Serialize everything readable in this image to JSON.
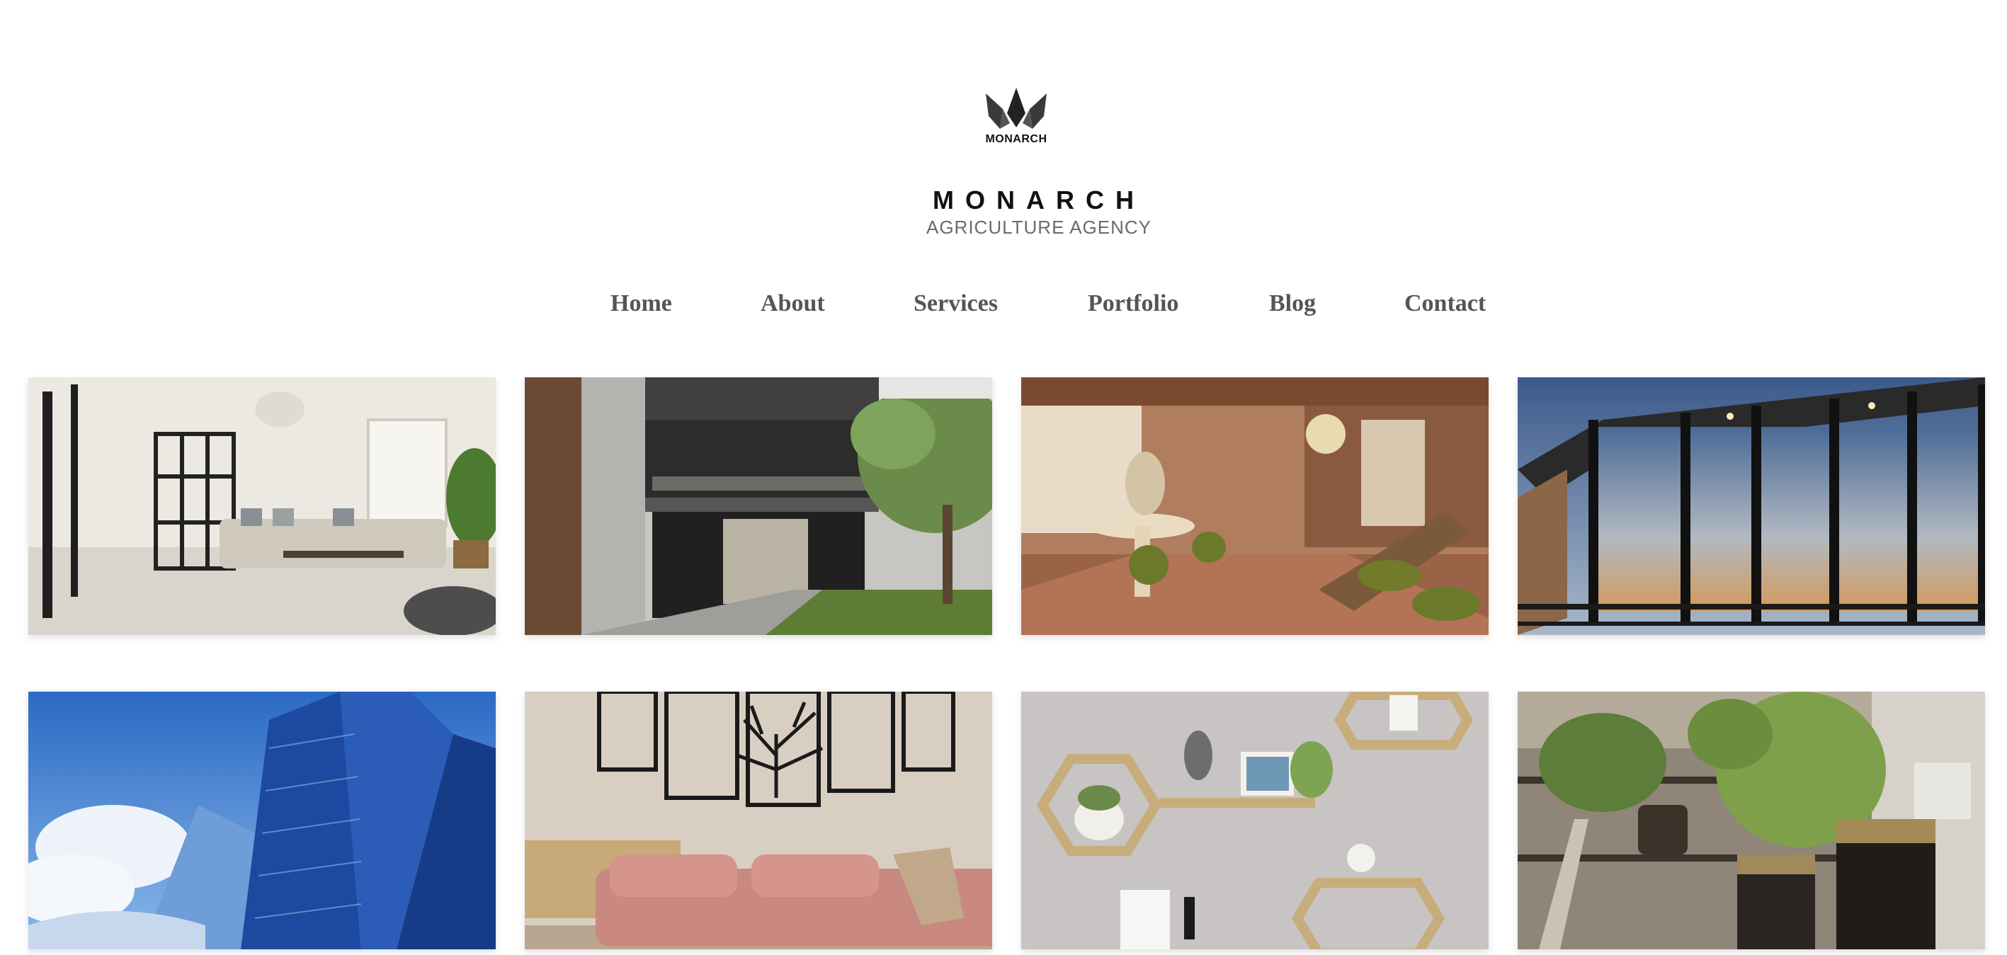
{
  "logo": {
    "icon": "crown-wings-logo",
    "text": "MONARCH"
  },
  "brand": {
    "name": "MONARCH",
    "tagline": "AGRICULTURE  AGENCY"
  },
  "nav": {
    "items": [
      {
        "label": "Home"
      },
      {
        "label": "About"
      },
      {
        "label": "Services"
      },
      {
        "label": "Portfolio"
      },
      {
        "label": "Blog"
      },
      {
        "label": "Contact"
      }
    ]
  },
  "gallery": {
    "images": [
      {
        "subject": "bright-living-room-with-glass-partition"
      },
      {
        "subject": "modern-house-with-garden-courtyard"
      },
      {
        "subject": "warm-retro-interior-with-dining-bar"
      },
      {
        "subject": "modern-glass-facade-balcony"
      },
      {
        "subject": "blue-glass-skyscrapers"
      },
      {
        "subject": "pink-sofa-with-tree-wall-art"
      },
      {
        "subject": "hexagon-wall-shelves"
      },
      {
        "subject": "potted-plants-on-shelves"
      }
    ]
  },
  "colors": {
    "nav_text": "#555555",
    "brand_text": "#111111",
    "tagline_text": "#6a6a6a",
    "background": "#ffffff"
  }
}
